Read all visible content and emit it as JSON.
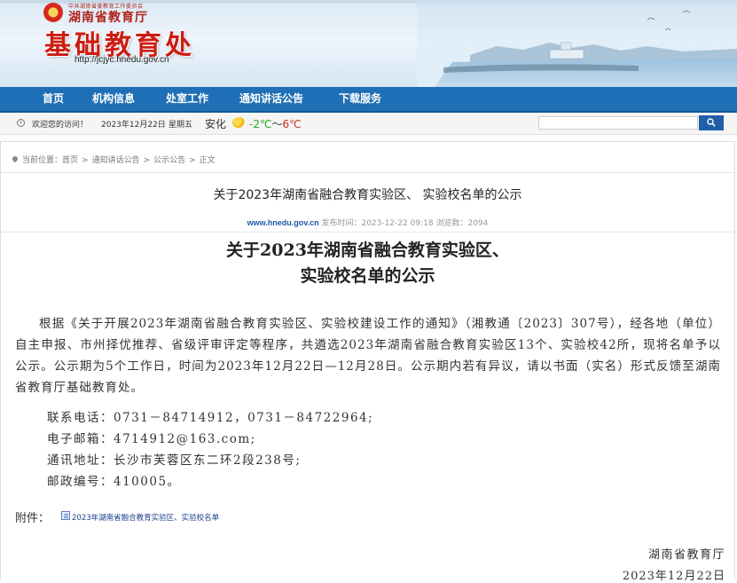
{
  "header": {
    "org_small": "中共湖南省委教育工作委员会",
    "org_name": "湖南省教育厅",
    "site_title": "基础教育处",
    "site_url": "http://jcjyc.hnedu.gov.cn"
  },
  "nav": {
    "items": [
      "首页",
      "机构信息",
      "处室工作",
      "通知讲话公告",
      "下载服务"
    ]
  },
  "welcome": {
    "greeting": "欢迎您的访问！",
    "date": "2023年12月22日",
    "weekday": "星期五",
    "city": "安化",
    "temp_low": "-2℃",
    "temp_sep": "～",
    "temp_high": "6℃",
    "weather_icon": "sun-cloud-icon"
  },
  "search": {
    "value": ""
  },
  "breadcrumb": {
    "prefix": "当前位置：",
    "items": [
      "首页",
      "通知讲话公告",
      "公示公告",
      "正文"
    ],
    "sep": ">"
  },
  "article": {
    "title": "关于2023年湖南省融合教育实验区、 实验校名单的公示",
    "source": "www.hnedu.gov.cn",
    "publish_label": "发布时间：",
    "publish_time": "2023-12-22 09:18",
    "views_label": "浏览数：",
    "views": "2094",
    "doc_title_line1": "关于2023年湖南省融合教育实验区、",
    "doc_title_line2": "实验校名单的公示",
    "body": "根据《关于开展2023年湖南省融合教育实验区、实验校建设工作的通知》（湘教通〔2023〕307号），经各地（单位）自主申报、市州择优推荐、省级评审评定等程序，共遴选2023年湖南省融合教育实验区13个、实验校42所，现将名单予以公示。公示期为5个工作日，时间为2023年12月22日—12月28日。公示期内若有异议，请以书面（实名）形式反馈至湖南省教育厅基础教育处。",
    "contacts": [
      "联系电话：0731－84714912，0731－84722964;",
      "电子邮箱：4714912@163.com;",
      "通讯地址：长沙市芙蓉区东二环2段238号;",
      "邮政编号：410005。"
    ],
    "attachment_label": "附件：",
    "attachment_name": "2023年湖南省融合教育实验区、实验校名单",
    "signature_org": "湖南省教育厅",
    "signature_date": "2023年12月22日"
  },
  "colors": {
    "nav_bg": "#1e6fb5",
    "title_red": "#cc1d12",
    "link_blue": "#1f56a8"
  }
}
